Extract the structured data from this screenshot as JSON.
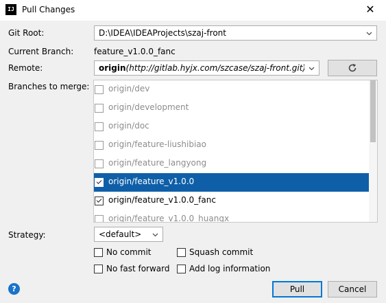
{
  "window": {
    "title": "Pull Changes",
    "close_glyph": "✕",
    "app_icon_text": "IJ"
  },
  "git_root": {
    "label": "Git Root:",
    "value": "D:\\IDEA\\IDEAProjects\\szaj-front"
  },
  "current_branch": {
    "label": "Current Branch:",
    "value": "feature_v1.0.0_fanc"
  },
  "remote": {
    "label": "Remote:",
    "name": "origin",
    "url": "(http://gitlab.hyjx.com/szcase/szaj-front.git)"
  },
  "branches": {
    "label": "Branches to merge:",
    "items": [
      {
        "name": "origin/dev",
        "checked": false,
        "selected": false,
        "dimmed": true
      },
      {
        "name": "origin/development",
        "checked": false,
        "selected": false,
        "dimmed": true
      },
      {
        "name": "origin/doc",
        "checked": false,
        "selected": false,
        "dimmed": true
      },
      {
        "name": "origin/feature-liushibiao",
        "checked": false,
        "selected": false,
        "dimmed": true
      },
      {
        "name": "origin/feature_langyong",
        "checked": false,
        "selected": false,
        "dimmed": true
      },
      {
        "name": "origin/feature_v1.0.0",
        "checked": true,
        "selected": true,
        "dimmed": false
      },
      {
        "name": "origin/feature_v1.0.0_fanc",
        "checked": true,
        "selected": false,
        "dimmed": false
      },
      {
        "name": "origin/feature_v1.0.0_huangx",
        "checked": false,
        "selected": false,
        "dimmed": true
      }
    ]
  },
  "strategy": {
    "label": "Strategy:",
    "value": "<default>"
  },
  "options": {
    "no_commit": "No commit",
    "squash_commit": "Squash commit",
    "no_fast_forward": "No fast forward",
    "add_log_information": "Add log information"
  },
  "buttons": {
    "pull": "Pull",
    "cancel": "Cancel",
    "help": "?"
  },
  "colors": {
    "selection": "#0f5fa8",
    "dialog_bg": "#f0f0f0",
    "primary_border": "#0078d7"
  }
}
